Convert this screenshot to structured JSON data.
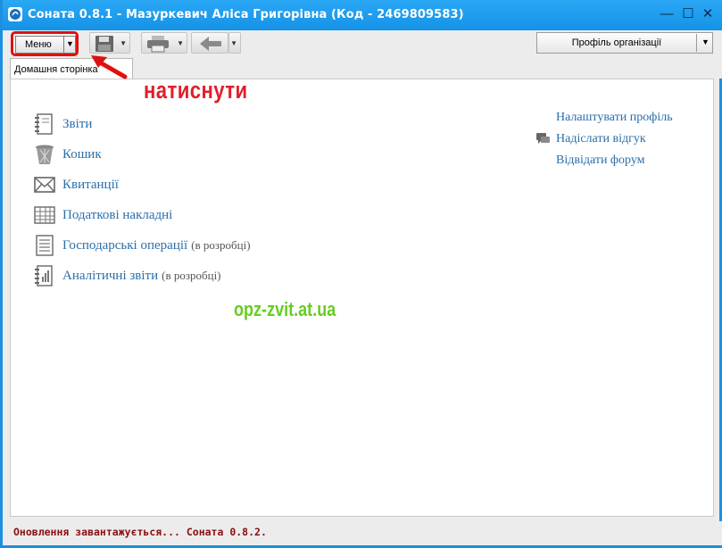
{
  "window": {
    "title": "Соната 0.8.1 - Мазуркевич Аліса Григорівна (Код - 2469809583)",
    "controls": [
      "minimize",
      "maximize",
      "close"
    ]
  },
  "toolbar": {
    "menu_label": "Меню",
    "save_icon": "floppy-disk-icon",
    "print_icon": "printer-icon",
    "back_icon": "arrow-left-icon",
    "profile_label": "Профіль організації"
  },
  "tabs": [
    {
      "label": "Домашня сторінка",
      "active": true
    }
  ],
  "annotation": {
    "text": "натиснути",
    "color": "#e0202a"
  },
  "home": {
    "items": [
      {
        "label": "Звіти",
        "note": "",
        "icon": "notebook-icon"
      },
      {
        "label": "Кошик",
        "note": "",
        "icon": "trash-icon"
      },
      {
        "label": "Квитанції",
        "note": "",
        "icon": "envelope-icon"
      },
      {
        "label": "Податкові накладні",
        "note": "",
        "icon": "table-icon"
      },
      {
        "label": "Господарські операції",
        "note": "(в розробці)",
        "icon": "document-icon"
      },
      {
        "label": "Аналітичні звіти",
        "note": "(в розробці)",
        "icon": "chart-notebook-icon"
      }
    ],
    "side_links": [
      {
        "label": "Налаштувати профіль"
      },
      {
        "label": "Надіслати відгук",
        "icon": "chat-icon"
      },
      {
        "label": "Відвідати форум"
      }
    ]
  },
  "watermark": "opz-zvit.at.ua",
  "status": {
    "message": "Оновлення завантажується... Соната 0.8.2."
  },
  "colors": {
    "titlebar": "#1da1f2",
    "link": "#2a6faa",
    "status_text": "#8b1010",
    "watermark": "#66cc22",
    "highlight": "#e01010"
  }
}
